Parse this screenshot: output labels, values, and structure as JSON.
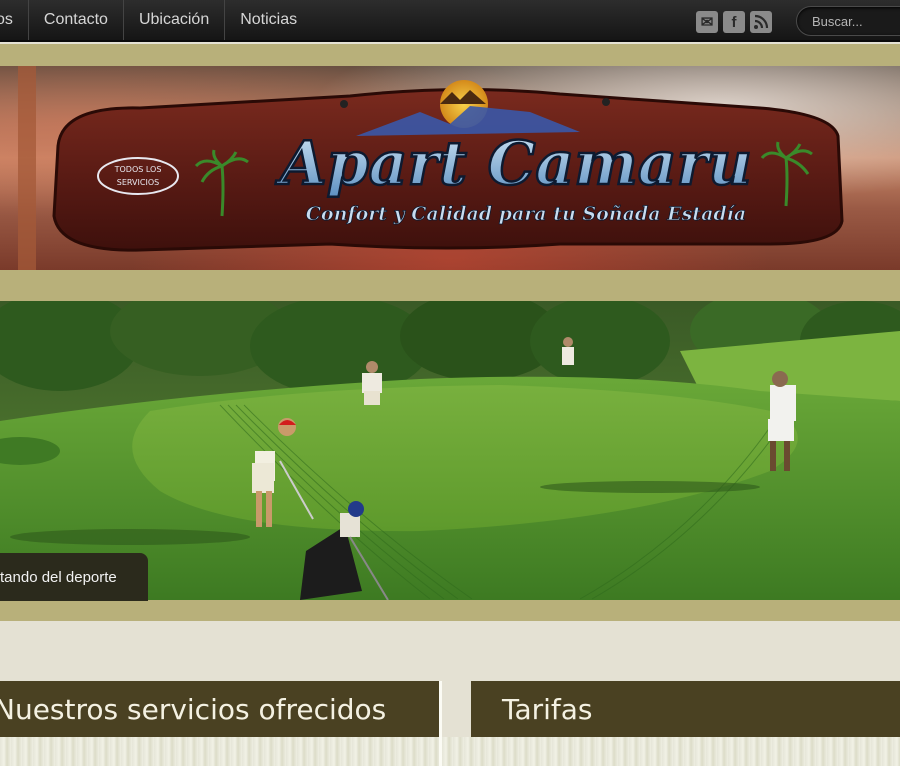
{
  "nav": {
    "items": [
      {
        "label": "os"
      },
      {
        "label": "Contacto"
      },
      {
        "label": "Ubicación"
      },
      {
        "label": "Noticias"
      }
    ]
  },
  "social": {
    "icons": [
      {
        "name": "mail-icon",
        "glyph": "✉"
      },
      {
        "name": "facebook-icon",
        "glyph": "f"
      },
      {
        "name": "rss-icon",
        "glyph": "◉"
      }
    ]
  },
  "search": {
    "placeholder": "Buscar..."
  },
  "banner": {
    "title": "Apart Camaru",
    "subtitle": "Confort y Calidad para tu Soñada Estadía",
    "badge_line1": "TODOS LOS",
    "badge_line2": "SERVICIOS"
  },
  "slide": {
    "caption": "tando del deporte"
  },
  "sections": {
    "services_title": "Nuestros servicios ofrecidos",
    "rates_title": "Tarifas"
  },
  "colors": {
    "band": "#b8b07a",
    "section_header": "#4a4122",
    "page_bg": "#e4e1d3"
  }
}
